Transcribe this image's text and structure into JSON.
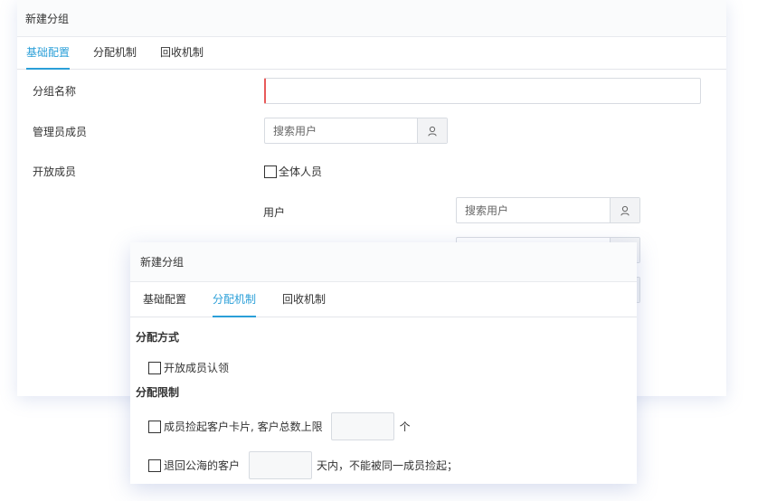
{
  "back_panel": {
    "title": "新建分组",
    "tabs": [
      {
        "label": "基础配置",
        "active": true
      },
      {
        "label": "分配机制",
        "active": false
      },
      {
        "label": "回收机制",
        "active": false
      }
    ],
    "fields": {
      "group_name_label": "分组名称",
      "admin_label": "管理员成员",
      "admin_search_placeholder": "搜索用户",
      "open_members_label": "开放成员",
      "all_members_label": "全体人员",
      "user_label": "用户",
      "user_search_placeholder": "搜索用户"
    }
  },
  "front_panel": {
    "title": "新建分组",
    "tabs": [
      {
        "label": "基础配置",
        "active": false
      },
      {
        "label": "分配机制",
        "active": true
      },
      {
        "label": "回收机制",
        "active": false
      }
    ],
    "allocation_method_heading": "分配方式",
    "open_members_claim_label": "开放成员认领",
    "allocation_limit_heading": "分配限制",
    "limit_row1_prefix": "成员捡起客户卡片, 客户总数上限",
    "limit_row1_suffix": "个",
    "limit_row2_prefix": "退回公海的客户",
    "limit_row2_suffix": "天内，不能被同一成员捡起；"
  },
  "colors": {
    "accent": "#2a9fd8",
    "required_border": "#e85a5a",
    "header_bg": "#fafbfc"
  },
  "icons": {
    "search_user": "user-icon"
  }
}
